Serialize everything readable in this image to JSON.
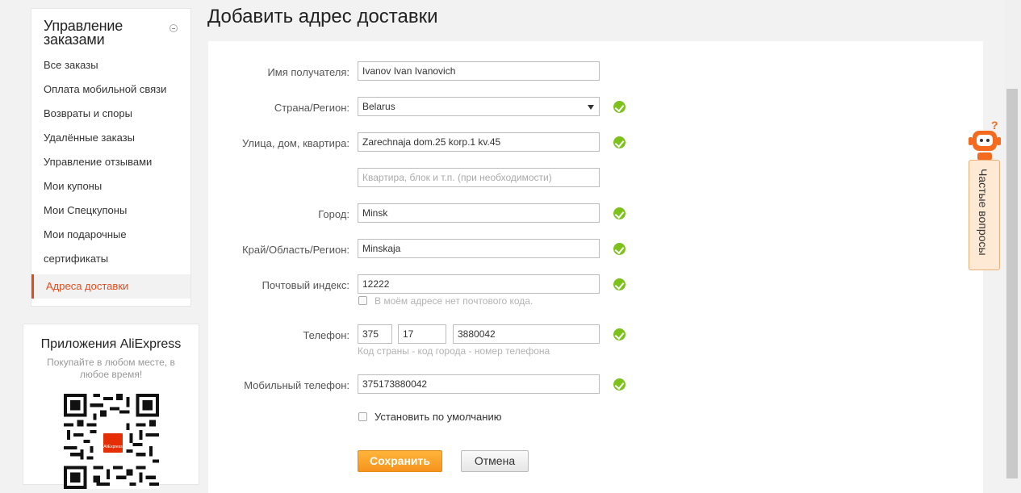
{
  "sidebar": {
    "title": "Управление заказами",
    "items": [
      {
        "label": "Все заказы"
      },
      {
        "label": "Оплата мобильной связи"
      },
      {
        "label": "Возвраты и споры"
      },
      {
        "label": "Удалённые заказы"
      },
      {
        "label": "Управление отзывами"
      },
      {
        "label": "Мои купоны"
      },
      {
        "label": "Мои Спецкупоны"
      },
      {
        "label": "Мои подарочные"
      },
      {
        "label": "сертификаты"
      },
      {
        "label": "Адреса доставки"
      }
    ]
  },
  "apps": {
    "title": "Приложения AliExpress",
    "subtitle": "Покупайте в любом месте, в любое время!",
    "qr_badge": "AliExpress"
  },
  "page": {
    "title": "Добавить адрес доставки"
  },
  "form": {
    "recipient": {
      "label": "Имя получателя:",
      "value": "Ivanov Ivan Ivanovich"
    },
    "country": {
      "label": "Страна/Регион:",
      "value": "Belarus"
    },
    "street": {
      "label": "Улица, дом, квартира:",
      "value": "Zarechnaja dom.25 korp.1 kv.45"
    },
    "apartment": {
      "placeholder": "Квартира, блок и т.п. (при необходимости)"
    },
    "city": {
      "label": "Город:",
      "value": "Minsk"
    },
    "region": {
      "label": "Край/Область/Регион:",
      "value": "Minskaja"
    },
    "zip": {
      "label": "Почтовый индекс:",
      "value": "12222",
      "no_zip_label": "В моём адресе нет почтового кода."
    },
    "phone": {
      "label": "Телефон:",
      "country_code": "375",
      "city_code": "17",
      "number": "3880042",
      "hint": "Код страны - код города - номер телефона"
    },
    "mobile": {
      "label": "Мобильный телефон:",
      "value": "375173880042"
    },
    "default_label": "Установить по умолчанию",
    "save_label": "Сохранить",
    "cancel_label": "Отмена"
  },
  "faq": {
    "label": "Частые вопросы"
  },
  "colors": {
    "accent": "#e64a19",
    "ok": "#7cc21b",
    "save": "#f7931e"
  }
}
